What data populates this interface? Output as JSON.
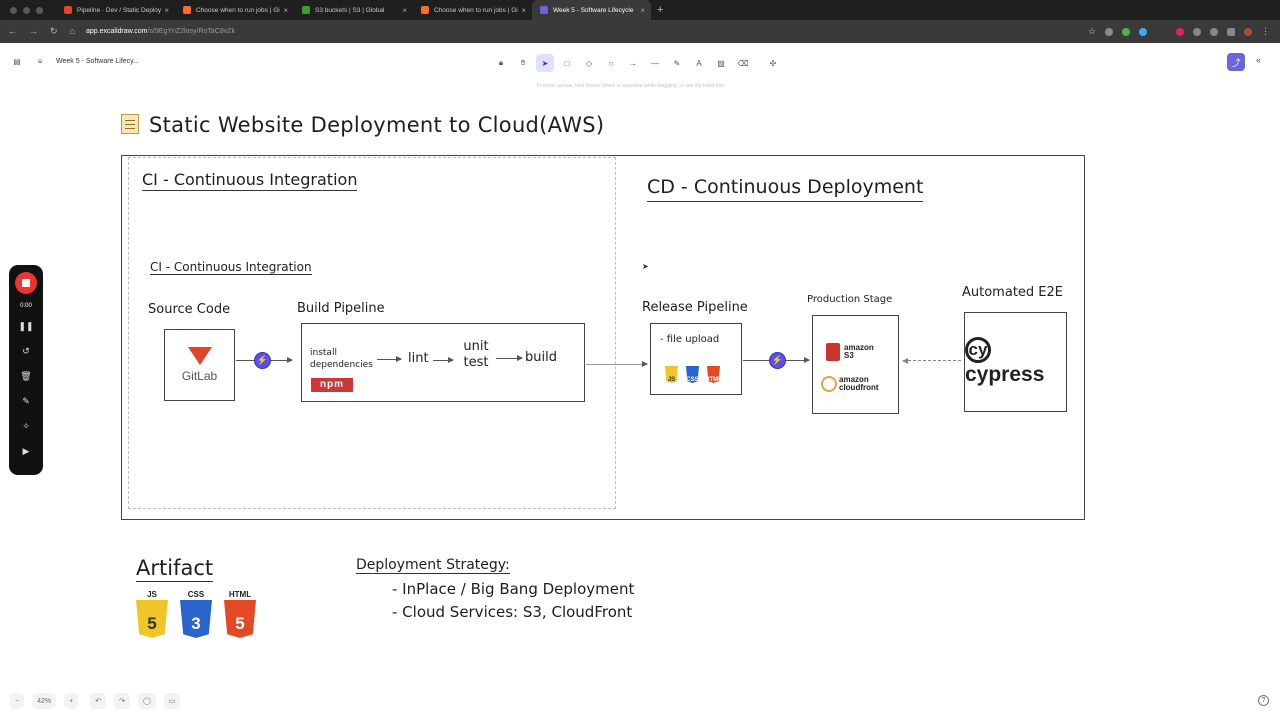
{
  "browser": {
    "tabs": [
      {
        "title": "Pipeline · Dev / Static Deploy",
        "favicon_color": "#e24329"
      },
      {
        "title": "Choose when to run jobs | Gi",
        "favicon_color": "#fc6d26"
      },
      {
        "title": "S3 buckets | S3 | Global",
        "favicon_color": "#3f9c35"
      },
      {
        "title": "Choose when to run jobs | Gi",
        "favicon_color": "#fc6d26"
      },
      {
        "title": "Week 5 - Software Lifecycle",
        "favicon_color": "#6965db",
        "active": true
      }
    ],
    "url_host": "app.excalidraw.com",
    "url_path": "/s/9EgYnZ2losy/RoTaC8vZk"
  },
  "excalidraw": {
    "doc_title": "Week 5 - Software Lifecy...",
    "hint": "To move canvas, hold mouse wheel or spacebar while dragging, or use the hand tool",
    "rec_time": "0:00",
    "zoom": "42%"
  },
  "canvas": {
    "title": "Static Website Deployment to Cloud(AWS)",
    "ci_heading": "CI - Continuous Integration",
    "cd_heading": "CD - Continuous Deployment",
    "ci_subheading": "CI - Continuous Integration",
    "source_code": "Source Code",
    "gitlab": "GitLab",
    "build_pipeline": "Build Pipeline",
    "install": "install dependencies",
    "npm": "npm",
    "lint": "lint",
    "unit_test": "unit test",
    "build": "build",
    "release_pipeline": "Release Pipeline",
    "file_upload": "- file upload",
    "production_stage": "Production Stage",
    "amazon_s3": "amazon S3",
    "amazon_cloudfront": "amazon cloudfront",
    "automated_e2e": "Automated E2E",
    "cypress": "cypress",
    "artifact": "Artifact",
    "js": "JS",
    "css": "CSS",
    "html": "HTML",
    "deployment_strategy": "Deployment Strategy:",
    "strategy_items": [
      "- InPlace / Big Bang Deployment",
      "- Cloud Services: S3, CloudFront"
    ]
  }
}
